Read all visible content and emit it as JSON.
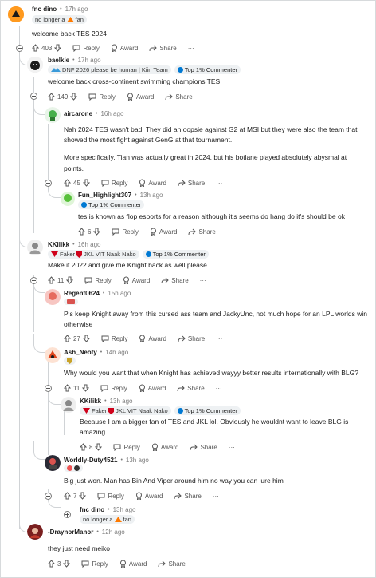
{
  "comments": [
    {
      "user": "fnc dino",
      "time": "17h ago",
      "flair": "no longer a",
      "flair2": "fan",
      "text": "welcome back TES 2024",
      "votes": "403"
    },
    {
      "user": "baelkie",
      "time": "17h ago",
      "flair": "DNF 2026 please be human | Kiin Team",
      "badge": "Top 1% Commenter",
      "text": "welcome back cross-continent swimming champions TES!",
      "votes": "149"
    },
    {
      "user": "aircarone",
      "time": "16h ago",
      "text1": "Nah 2024 TES wasn't bad. They did an oopsie against G2 at MSI but they were also the team that",
      "text2": "showed the most fight against GenG at that tournament.",
      "text3": "More specifically, Tian was actually great in 2024, but his botlane played absolutely abysmal at",
      "text4": "points.",
      "votes": "45"
    },
    {
      "user": "Fun_Highlight307",
      "time": "13h ago",
      "badge": "Top 1% Commenter",
      "text": "tes is known as flop esports for a reason although it's seems do hang do it's should be ok",
      "votes": "6"
    },
    {
      "user": "KKilikk",
      "time": "16h ago",
      "flair": "Faker",
      "flair2": "JKL VIT Naak Nako",
      "badge": "Top 1% Commenter",
      "text": "Make it 2022 and give me Knight back as well please.",
      "votes": "11"
    },
    {
      "user": "Regent0624",
      "time": "15h ago",
      "text1": "Pls keep Knight away from this cursed ass team and JackyUnc, not much hope for an LPL worlds win",
      "text2": "otherwise",
      "votes": "27"
    },
    {
      "user": "Ash_Neofy",
      "time": "14h ago",
      "text": "Why would you want that when Knight has achieved wayyy better results internationally with BLG?",
      "votes": "11"
    },
    {
      "user": "KKilikk",
      "time": "13h ago",
      "flair": "Faker",
      "flair2": "JKL VIT Naak Nako",
      "badge": "Top 1% Commenter",
      "text1": "Because I am a bigger fan of TES and JKL lol. Obviously he wouldnt want to leave BLG is",
      "text2": "amazing.",
      "votes": "8"
    },
    {
      "user": "Worldly-Duty4521",
      "time": "13h ago",
      "text": "Blg just won. Man has Bin And Viper around him no way you can lure him",
      "votes": "7"
    },
    {
      "user": "fnc dino",
      "time": "13h ago",
      "flair": "no longer a",
      "flair2": "fan"
    },
    {
      "user": "-DraynorManor",
      "time": "12h ago",
      "text": "they just need meiko",
      "votes": "3"
    }
  ],
  "actions": {
    "reply": "Reply",
    "award": "Award",
    "share": "Share",
    "more": "···"
  },
  "colors": {
    "accent": "#0079d3",
    "upvote": "#555555"
  }
}
